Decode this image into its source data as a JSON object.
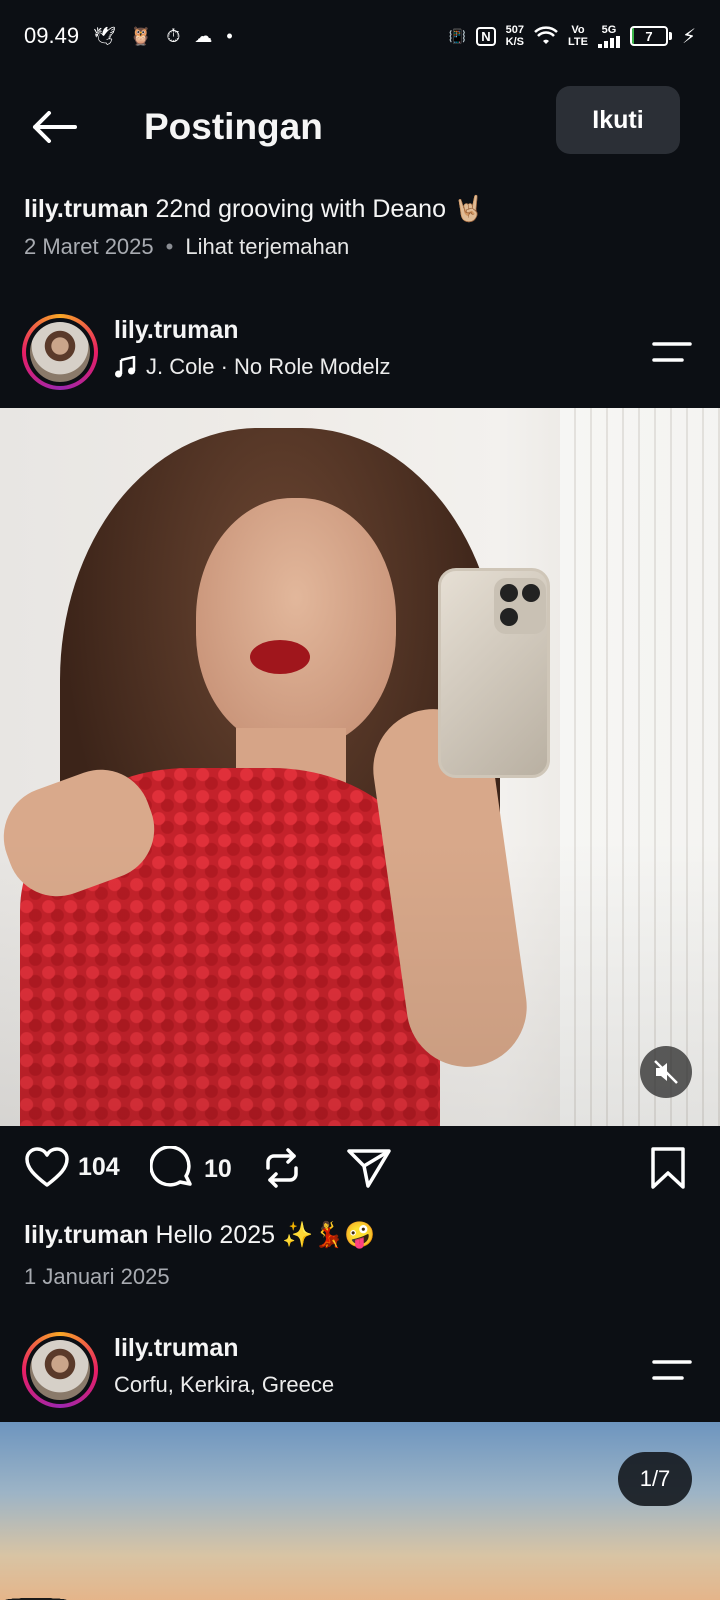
{
  "status_bar": {
    "time": "09.49",
    "net_speed_value": "507",
    "net_speed_unit": "K/S",
    "network_type": "5G",
    "volte_top": "Vo",
    "volte_bottom": "LTE",
    "battery_level": "7",
    "battery_color": "#3bb54a"
  },
  "header": {
    "title": "Postingan",
    "follow_label": "Ikuti"
  },
  "top_caption": {
    "username": "lily.truman",
    "text": "22nd grooving with Deano 🤘🏼",
    "date": "2 Maret 2025",
    "translate_label": "Lihat terjemahan"
  },
  "post1": {
    "username": "lily.truman",
    "audio": "J. Cole · No Role Modelz",
    "likes": "104",
    "comments": "10",
    "caption_username": "lily.truman",
    "caption_text": "Hello 2025 ✨💃🤪",
    "date": "1 Januari 2025"
  },
  "post2": {
    "username": "lily.truman",
    "location": "Corfu, Kerkira, Greece",
    "carousel_counter": "1/7"
  },
  "colors": {
    "background": "#0c0f14",
    "follow_button_bg": "#2b2f36",
    "secondary_text": "#a8abb1"
  }
}
